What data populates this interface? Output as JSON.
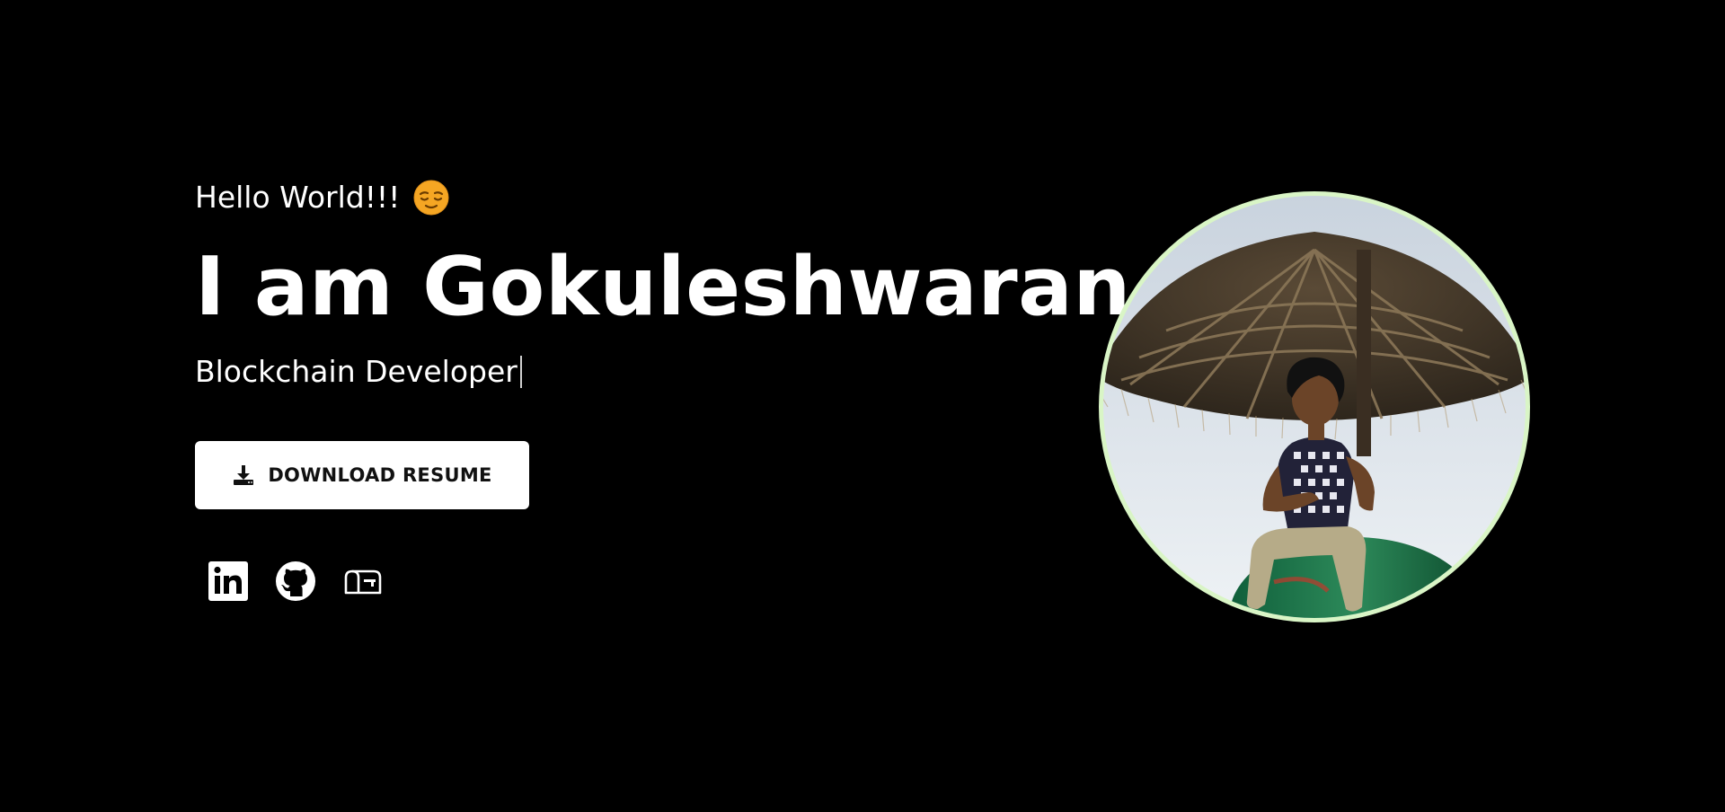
{
  "hero": {
    "greeting": "Hello World!!!",
    "greeting_emoji": "relieved-face-icon",
    "name_heading": "I am Gokuleshwaran",
    "role": "Blockchain Developer",
    "resume_button": {
      "label": "DOWNLOAD RESUME",
      "icon": "download-icon"
    },
    "socials": [
      {
        "icon": "linkedin-icon"
      },
      {
        "icon": "github-icon"
      },
      {
        "icon": "mailbox-icon"
      }
    ]
  },
  "colors": {
    "background": "#000000",
    "text": "#ffffff",
    "button_bg": "#ffffff",
    "button_text": "#111111",
    "avatar_ring": "#d9f5c6",
    "emoji": "#f5a623"
  }
}
